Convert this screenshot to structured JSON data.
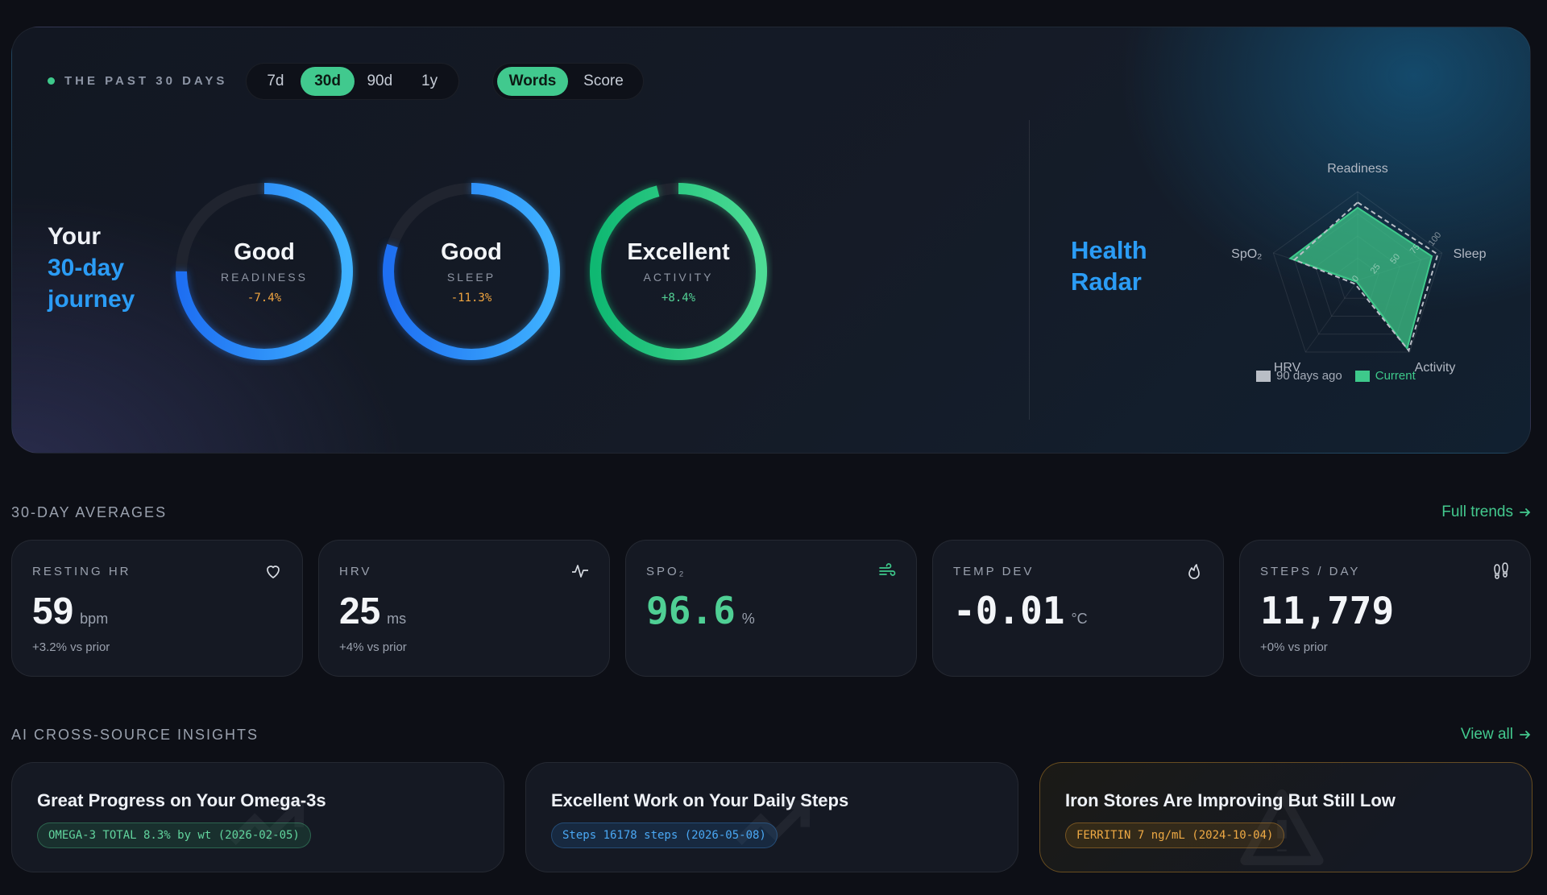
{
  "hero": {
    "period_label": "THE PAST 30 DAYS",
    "range_options": [
      "7d",
      "30d",
      "90d",
      "1y"
    ],
    "range_selected": "30d",
    "mode_options": [
      "Words",
      "Score"
    ],
    "mode_selected": "Words",
    "journey_line1": "Your",
    "journey_line2": "30-day",
    "journey_line3": "journey",
    "rings": [
      {
        "word": "Good",
        "label": "READINESS",
        "delta": "-7.4%",
        "fraction": 0.75,
        "color_start": "#1e6ff2",
        "color_end": "#3fb2ff",
        "trend": "negative"
      },
      {
        "word": "Good",
        "label": "SLEEP",
        "delta": "-11.3%",
        "fraction": 0.8,
        "color_start": "#1e6ff2",
        "color_end": "#3fb2ff",
        "trend": "negative"
      },
      {
        "word": "Excellent",
        "label": "ACTIVITY",
        "delta": "+8.4%",
        "fraction": 0.96,
        "color_start": "#0fb872",
        "color_end": "#4ddc95",
        "trend": "positive"
      }
    ]
  },
  "radar": {
    "title_line1": "Health",
    "title_line2": "Radar",
    "axes": [
      "Readiness",
      "Sleep",
      "Activity",
      "HRV",
      "SpO₂"
    ],
    "ticks": [
      "0",
      "25",
      "50",
      "75",
      "100"
    ],
    "series": [
      {
        "name": "90 days ago",
        "values": [
          88,
          95,
          98,
          5,
          75
        ],
        "color": "#b9bec6"
      },
      {
        "name": "Current",
        "values": [
          82,
          88,
          95,
          2,
          80
        ],
        "color": "#3ec98b"
      }
    ]
  },
  "averages": {
    "title": "30-DAY AVERAGES",
    "link": "Full trends",
    "cards": [
      {
        "label": "RESTING HR",
        "value": "59",
        "unit": "bpm",
        "sub": "+3.2% vs prior",
        "icon": "heart-icon"
      },
      {
        "label": "HRV",
        "value": "25",
        "unit": "ms",
        "sub": "+4% vs prior",
        "icon": "pulse-icon"
      },
      {
        "label": "SPO₂",
        "value": "96.6",
        "unit": "%",
        "sub": "",
        "icon": "wind-icon"
      },
      {
        "label": "TEMP DEV",
        "value": "-0.01",
        "unit": "°C",
        "sub": "",
        "icon": "flame-icon"
      },
      {
        "label": "STEPS / DAY",
        "value": "11,779",
        "unit": "",
        "sub": "+0% vs prior",
        "icon": "footprints-icon"
      }
    ]
  },
  "insights": {
    "title": "AI CROSS-SOURCE INSIGHTS",
    "link": "View all",
    "cards": [
      {
        "title": "Great Progress on Your Omega-3s",
        "tag": "OMEGA-3 TOTAL 8.3% by wt (2026-02-05)",
        "tone": "green"
      },
      {
        "title": "Excellent Work on Your Daily Steps",
        "tag": "Steps 16178 steps (2026-05-08)",
        "tone": "blue"
      },
      {
        "title": "Iron Stores Are Improving But Still Low",
        "tag": "FERRITIN 7 ng/mL (2024-10-04)",
        "tone": "amber"
      }
    ]
  }
}
